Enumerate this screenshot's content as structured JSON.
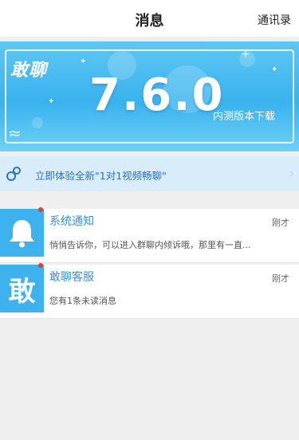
{
  "header": {
    "title": "消息",
    "contacts_label": "通讯录"
  },
  "banner": {
    "logo_text": "敢聊",
    "version": "7.6.0",
    "subtitle": "内测版本下载"
  },
  "promo": {
    "text": "立即体验全新\"1对1视频畅聊\"",
    "icon": "link-icon",
    "chevron": "›"
  },
  "conversations": [
    {
      "name": "系统通知",
      "time": "刚才",
      "preview": "悄悄告诉你，可以进入群聊内倾诉哦，那里有一直...",
      "avatar_icon": "bell-icon",
      "unread": true
    },
    {
      "name": "敢聊客服",
      "time": "刚才",
      "preview": "您有1条未读消息",
      "avatar_icon": "app-logo-icon",
      "avatar_glyph": "敢",
      "unread": true
    }
  ],
  "colors": {
    "accent": "#3db2ee",
    "link": "#2a74c4",
    "unread": "#e53935"
  }
}
